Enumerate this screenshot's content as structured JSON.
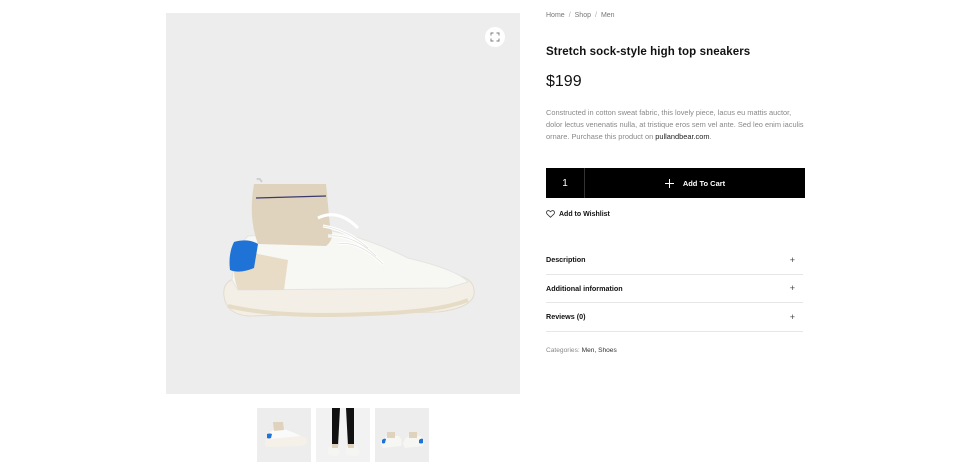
{
  "breadcrumb": {
    "home": "Home",
    "shop": "Shop",
    "current": "Men",
    "separator": "/"
  },
  "product": {
    "title": "Stretch sock-style high top sneakers",
    "price": "$199",
    "description": "Constructed in cotton sweat fabric, this lovely piece, lacus eu mattis auctor, dolor lectus venenatis nulla, at tristique eros sem vel ante. Sed leo enim iaculis ornare. Purchase this product on ",
    "description_link": "pullandbear.com",
    "description_end": "."
  },
  "cart": {
    "quantity": "1",
    "add_label": "Add To Cart"
  },
  "wishlist": {
    "label": "Add to Wishlist"
  },
  "accordion": [
    {
      "label": "Description",
      "icon": "+"
    },
    {
      "label": "Additional information",
      "icon": "+"
    },
    {
      "label": "Reviews (0)",
      "icon": "+"
    }
  ],
  "categories": {
    "label": "Categories:",
    "value": "Men, Shoes"
  },
  "icons": {
    "zoom": "expand-icon",
    "wishlist": "heart-icon",
    "cart": "plus-icon"
  },
  "colors": {
    "accent": "#000000",
    "gallery_bg": "#ededed",
    "shoe_blue": "#1f73d6",
    "shoe_beige": "#dfd3bd"
  }
}
